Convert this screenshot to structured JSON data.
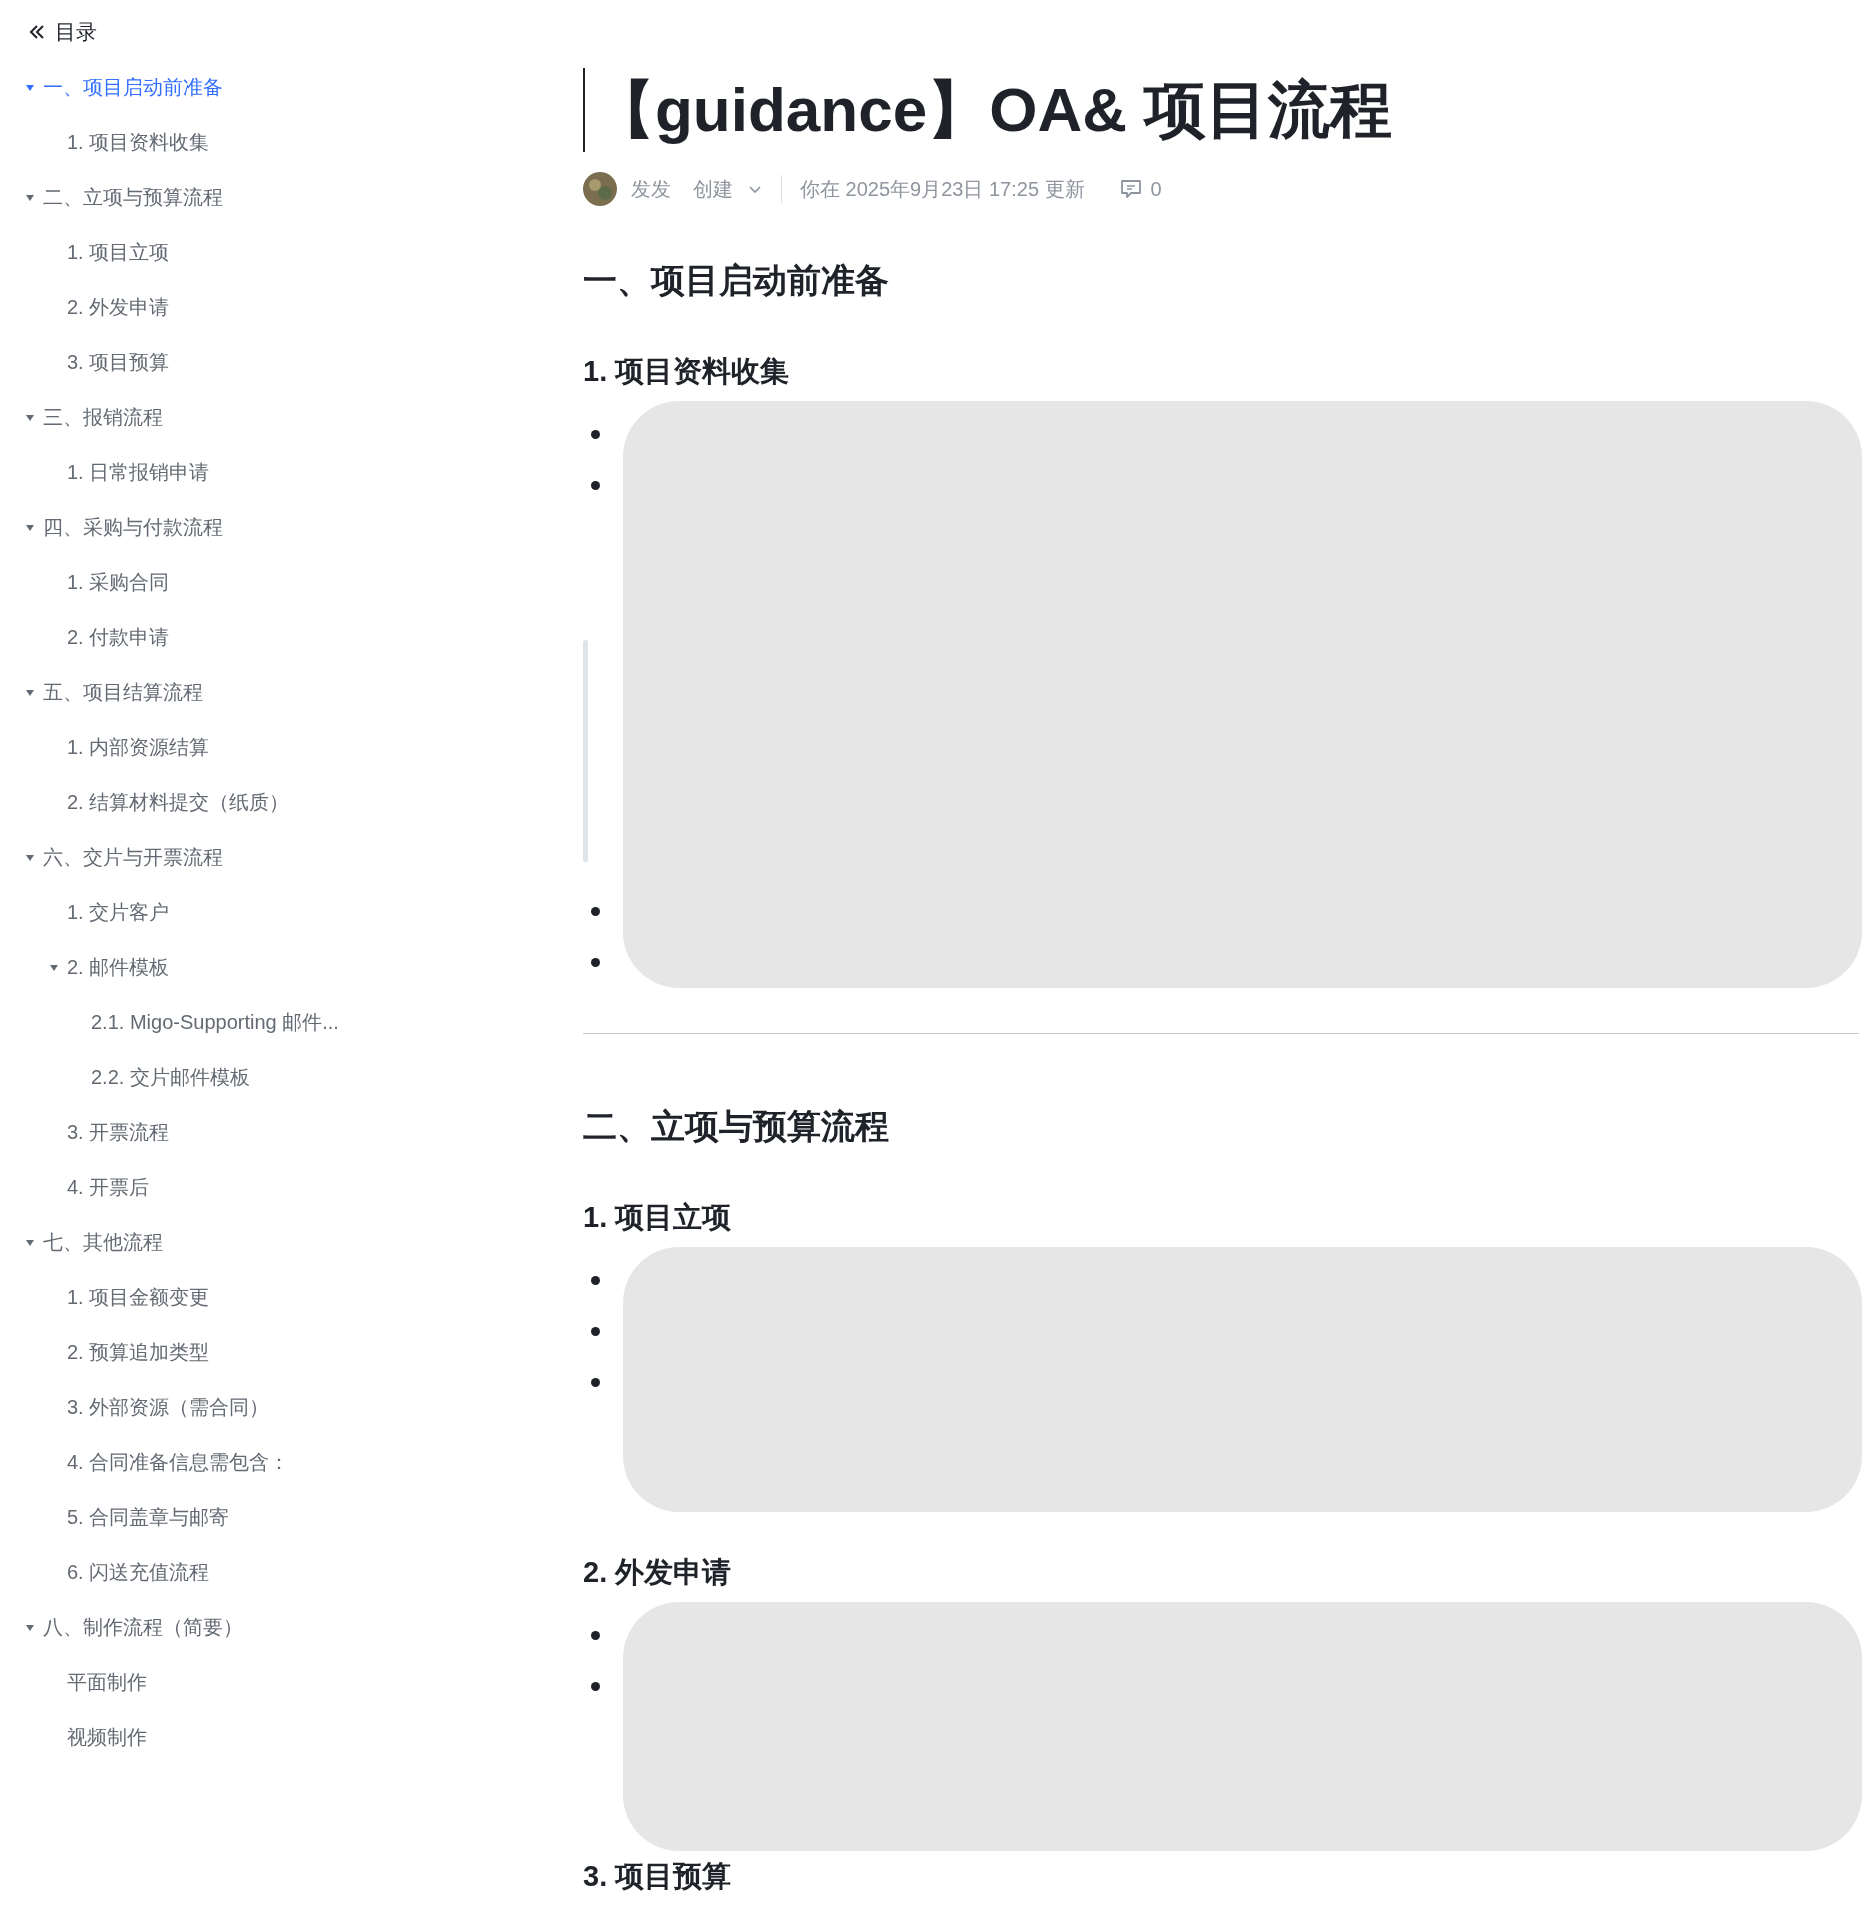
{
  "sidebar": {
    "title": "目录",
    "items": [
      {
        "label": "一、项目启动前准备",
        "selected": true,
        "expanded": true,
        "children": [
          {
            "label": "1. 项目资料收集",
            "selected": false
          }
        ]
      },
      {
        "label": "二、立项与预算流程",
        "selected": false,
        "expanded": true,
        "children": [
          {
            "label": "1. 项目立项",
            "selected": false
          },
          {
            "label": "2. 外发申请",
            "selected": false
          },
          {
            "label": "3. 项目预算",
            "selected": false
          }
        ]
      },
      {
        "label": "三、报销流程",
        "selected": false,
        "expanded": true,
        "children": [
          {
            "label": "1. 日常报销申请",
            "selected": false
          }
        ]
      },
      {
        "label": "四、采购与付款流程",
        "selected": false,
        "expanded": true,
        "children": [
          {
            "label": "1. 采购合同",
            "selected": false
          },
          {
            "label": "2. 付款申请",
            "selected": false
          }
        ]
      },
      {
        "label": "五、项目结算流程",
        "selected": false,
        "expanded": true,
        "children": [
          {
            "label": "1. 内部资源结算",
            "selected": false
          },
          {
            "label": "2. 结算材料提交（纸质）",
            "selected": false
          }
        ]
      },
      {
        "label": "六、交片与开票流程",
        "selected": false,
        "expanded": true,
        "children": [
          {
            "label": "1.  交片客户",
            "selected": false
          },
          {
            "label": "2.  邮件模板",
            "selected": false,
            "expanded": true,
            "children": [
              {
                "label": "2.1.  Migo-Supporting 邮件...",
                "selected": false
              },
              {
                "label": "2.2.  交片邮件模板",
                "selected": false
              }
            ]
          },
          {
            "label": "3.  开票流程",
            "selected": false
          },
          {
            "label": "4. 开票后",
            "selected": false
          }
        ]
      },
      {
        "label": "七、其他流程",
        "selected": false,
        "expanded": true,
        "children": [
          {
            "label": "1.  项目金额变更",
            "selected": false
          },
          {
            "label": "2.  预算追加类型",
            "selected": false
          },
          {
            "label": "3.  外部资源（需合同）",
            "selected": false
          },
          {
            "label": "4.  合同准备信息需包含：",
            "selected": false
          },
          {
            "label": "5.  合同盖章与邮寄",
            "selected": false
          },
          {
            "label": "6.  闪送充值流程",
            "selected": false
          }
        ]
      },
      {
        "label": "八、制作流程（简要）",
        "selected": false,
        "expanded": true,
        "children": [
          {
            "label": "平面制作",
            "selected": false
          },
          {
            "label": "视频制作",
            "selected": false
          }
        ]
      }
    ]
  },
  "document": {
    "title": "【guidance】OA& 项目流程",
    "meta": {
      "author": "发发",
      "action": "创建",
      "updated": "你在 2025年9月23日 17:25 更新",
      "comments": "0"
    },
    "blocks": [
      {
        "kind": "h1",
        "text": "一、项目启动前准备"
      },
      {
        "kind": "h2",
        "text": "1. 项目资料收集"
      },
      {
        "kind": "list",
        "redacted": true,
        "items": [
          {
            "kind": "line"
          },
          {
            "kind": "tall"
          },
          {
            "kind": "line"
          },
          {
            "kind": "line"
          }
        ]
      },
      {
        "kind": "divider"
      },
      {
        "kind": "h1",
        "text": "二、立项与预算流程"
      },
      {
        "kind": "h2",
        "text": "1. 项目立项"
      },
      {
        "kind": "list",
        "redacted": true,
        "items": [
          {
            "kind": "line"
          },
          {
            "kind": "line"
          },
          {
            "kind": "tall"
          }
        ]
      },
      {
        "kind": "h2",
        "text": "2. 外发申请"
      },
      {
        "kind": "list",
        "redacted": true,
        "items": [
          {
            "kind": "line"
          },
          {
            "kind": "tall"
          }
        ]
      },
      {
        "kind": "h2",
        "text": "3. 项目预算"
      }
    ]
  }
}
